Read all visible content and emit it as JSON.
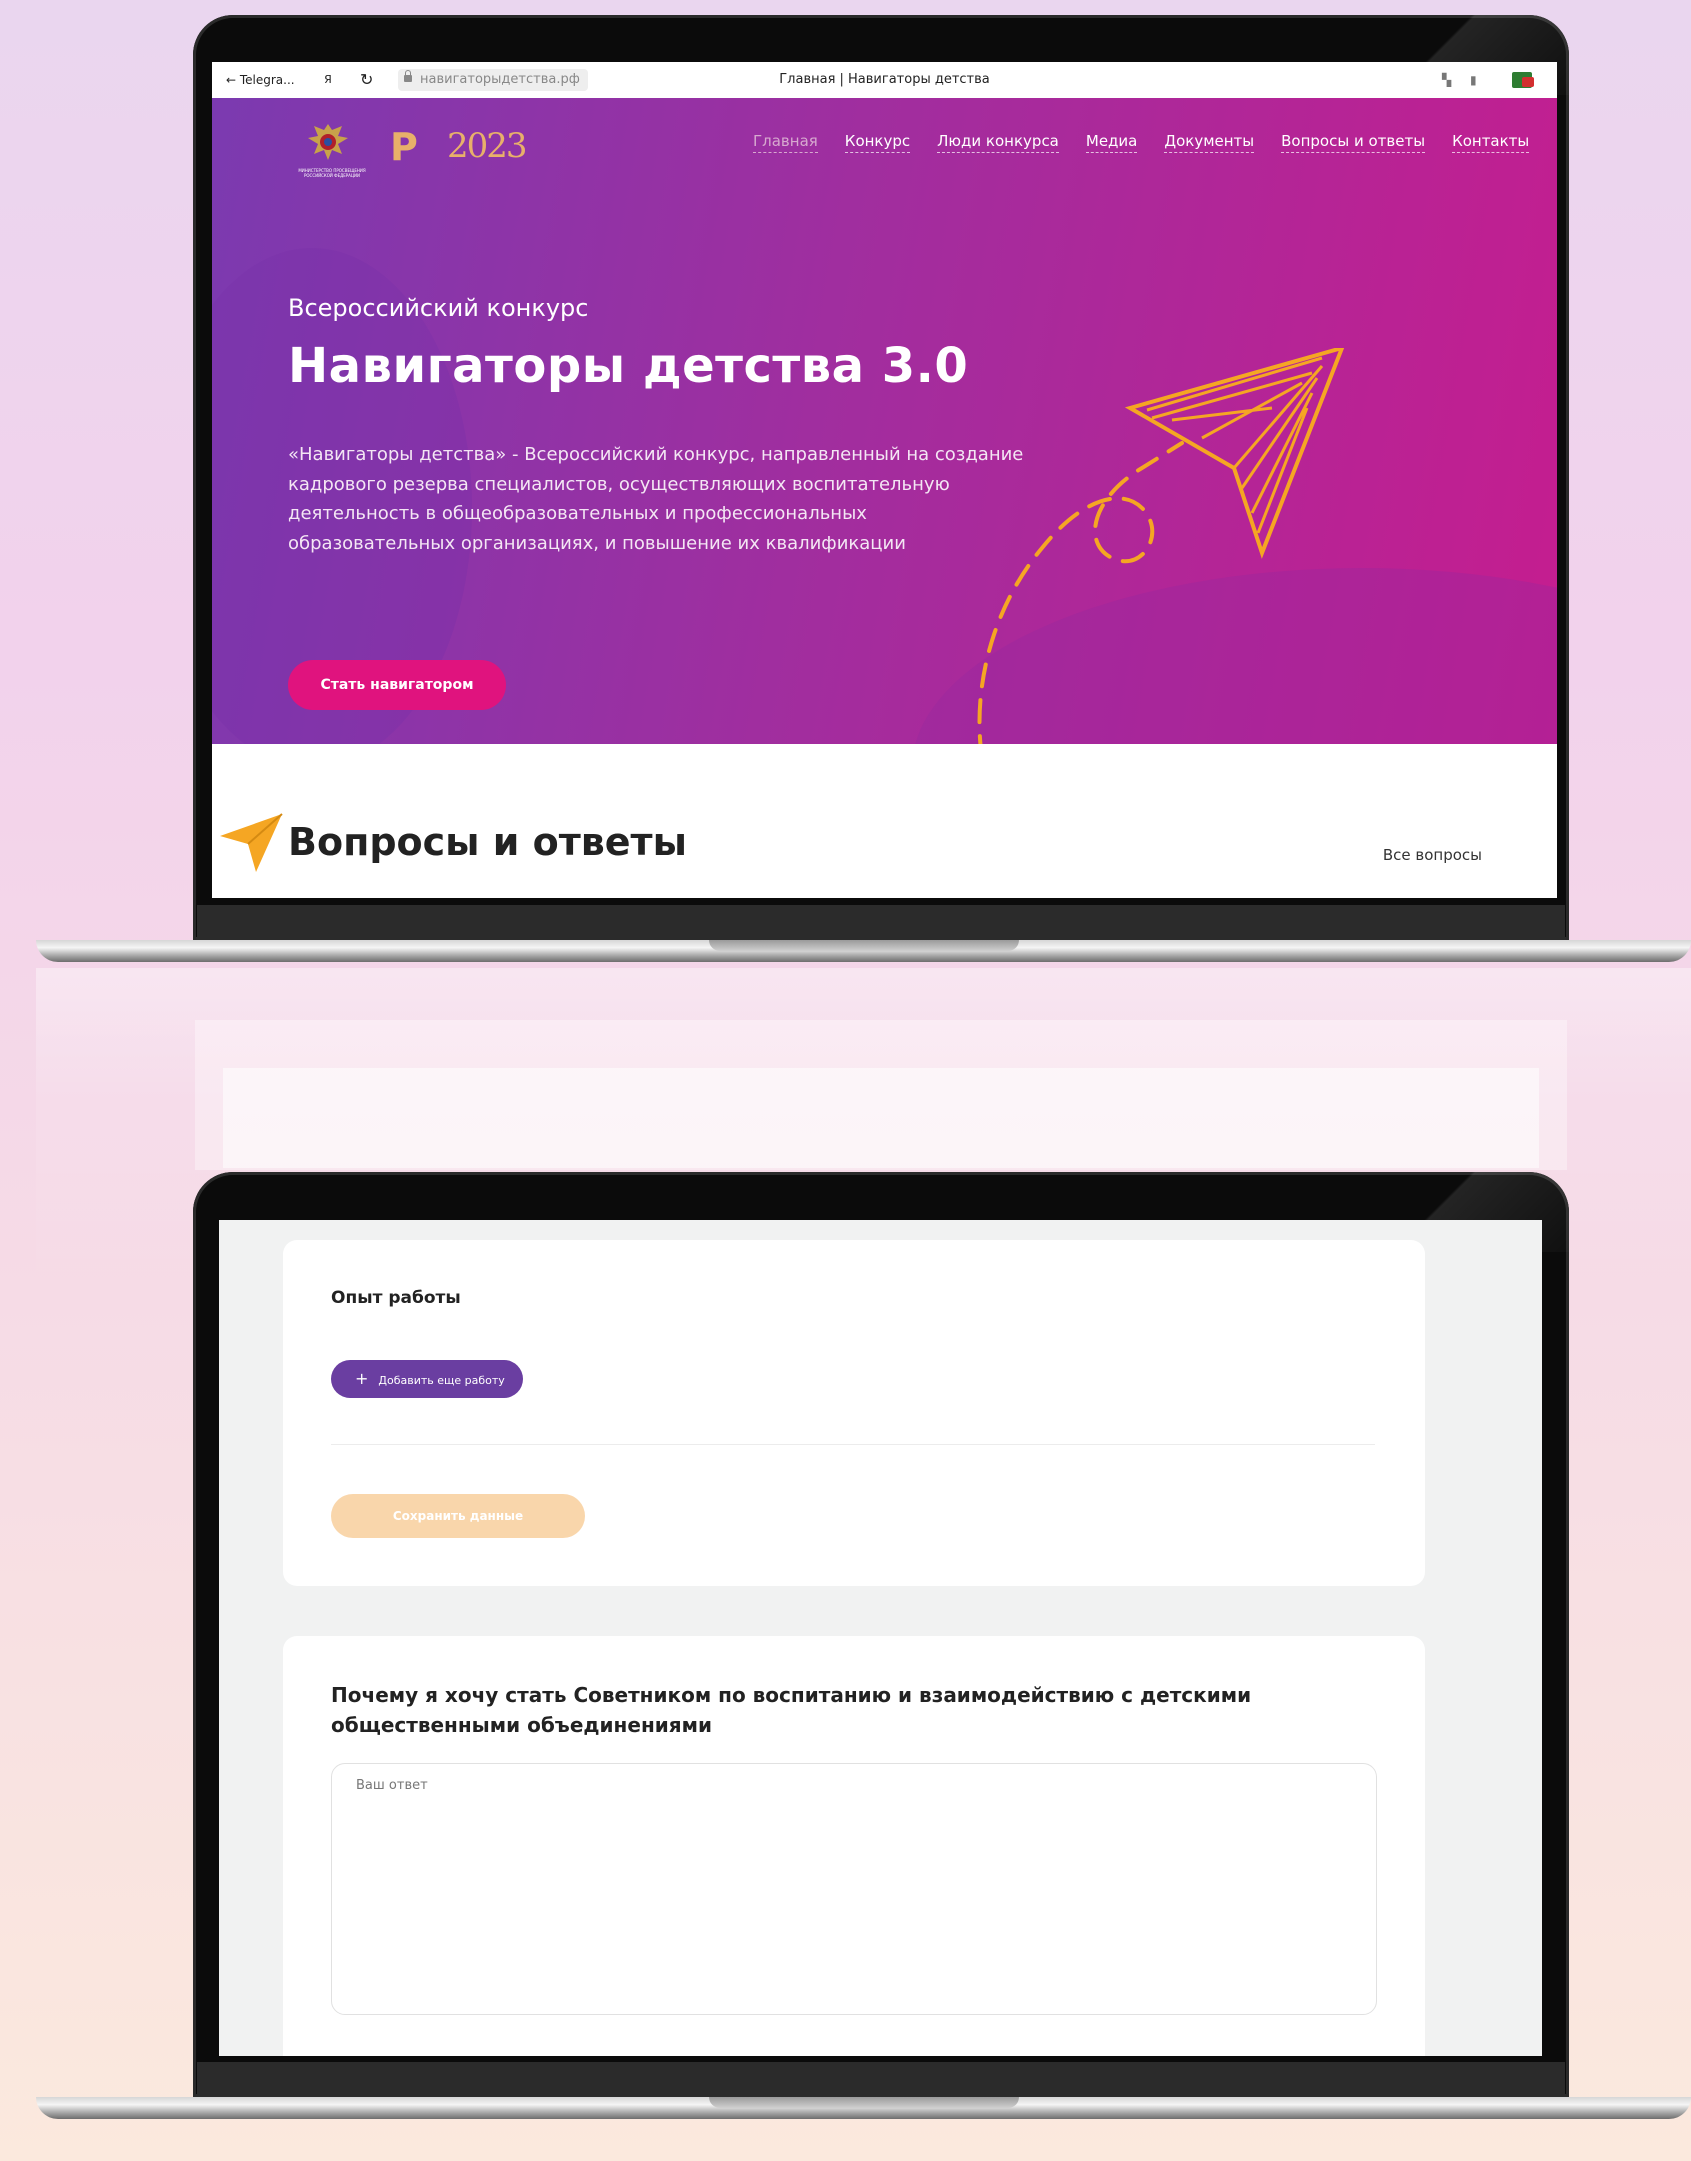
{
  "browser": {
    "back_label": "← Telegra...",
    "yandex_icon": "Я",
    "reload_icon": "↻",
    "url": "навигаторыдетства.рф",
    "tab_title": "Главная | Навигаторы детства"
  },
  "header": {
    "ministry_text": "МИНИСТЕРСТВО ПРОСВЕЩЕНИЯ РОССИЙСКОЙ ФЕДЕРАЦИИ",
    "logo_p": "Р",
    "logo_year": "2023",
    "nav": [
      "Главная",
      "Конкурс",
      "Люди конкурса",
      "Медиа",
      "Документы",
      "Вопросы и ответы",
      "Контакты"
    ],
    "active_nav": "Главная"
  },
  "hero": {
    "subtitle": "Всероссийский конкурс",
    "title": "Навигаторы детства 3.0",
    "description": "«Навигаторы детства» - Всероссийский конкурс, направленный на создание кадрового резерва специалистов, осуществляющих воспитательную деятельность в общеобразовательных и профессиональных образовательных организациях, и повышение их квалификации",
    "cta_label": "Стать навигатором"
  },
  "faq": {
    "title": "Вопросы и ответы",
    "all_link": "Все вопросы"
  },
  "form": {
    "experience_title": "Опыт работы",
    "add_work_label": "Добавить еще работу",
    "save_label": "Сохранить данные",
    "question_title": "Почему я хочу стать Советником по воспитанию и взаимодействию с детскими общественными объединениями",
    "answer_placeholder": "Ваш ответ"
  },
  "colors": {
    "hero_start": "#7b3ab0",
    "hero_end": "#c51d8f",
    "cta": "#e0137e",
    "accent_orange": "#f5a623",
    "add_button": "#6a3ea1",
    "save_button": "#f9d6ab"
  }
}
